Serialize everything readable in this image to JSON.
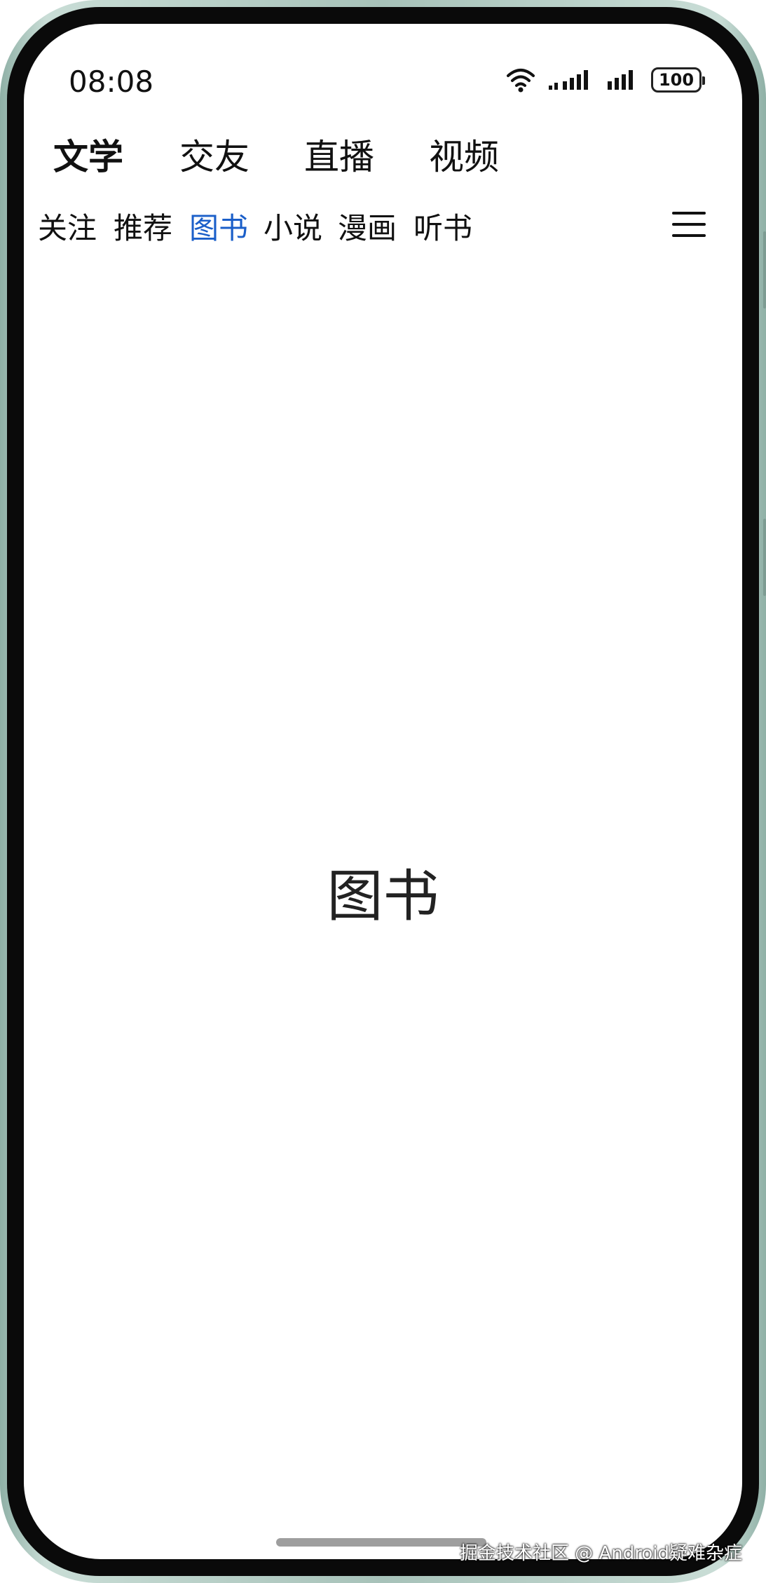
{
  "status_bar": {
    "time": "08:08",
    "battery": "100",
    "icons": [
      "wifi-icon",
      "signal-icon",
      "signal-icon",
      "battery-icon"
    ]
  },
  "top_tabs": [
    {
      "label": "文学",
      "active": true
    },
    {
      "label": "交友",
      "active": false
    },
    {
      "label": "直播",
      "active": false
    },
    {
      "label": "视频",
      "active": false
    }
  ],
  "sub_tabs": [
    {
      "label": "关注",
      "active": false
    },
    {
      "label": "推荐",
      "active": false
    },
    {
      "label": "图书",
      "active": true
    },
    {
      "label": "小说",
      "active": false
    },
    {
      "label": "漫画",
      "active": false
    },
    {
      "label": "听书",
      "active": false
    }
  ],
  "menu_icon": "menu-icon",
  "content": {
    "title": "图书"
  },
  "watermark": "掘金技术社区 @ Android疑难杂症",
  "colors": {
    "active_sub_tab": "#1b5fc9",
    "text": "#111111",
    "frame": "#a7c2b9"
  }
}
